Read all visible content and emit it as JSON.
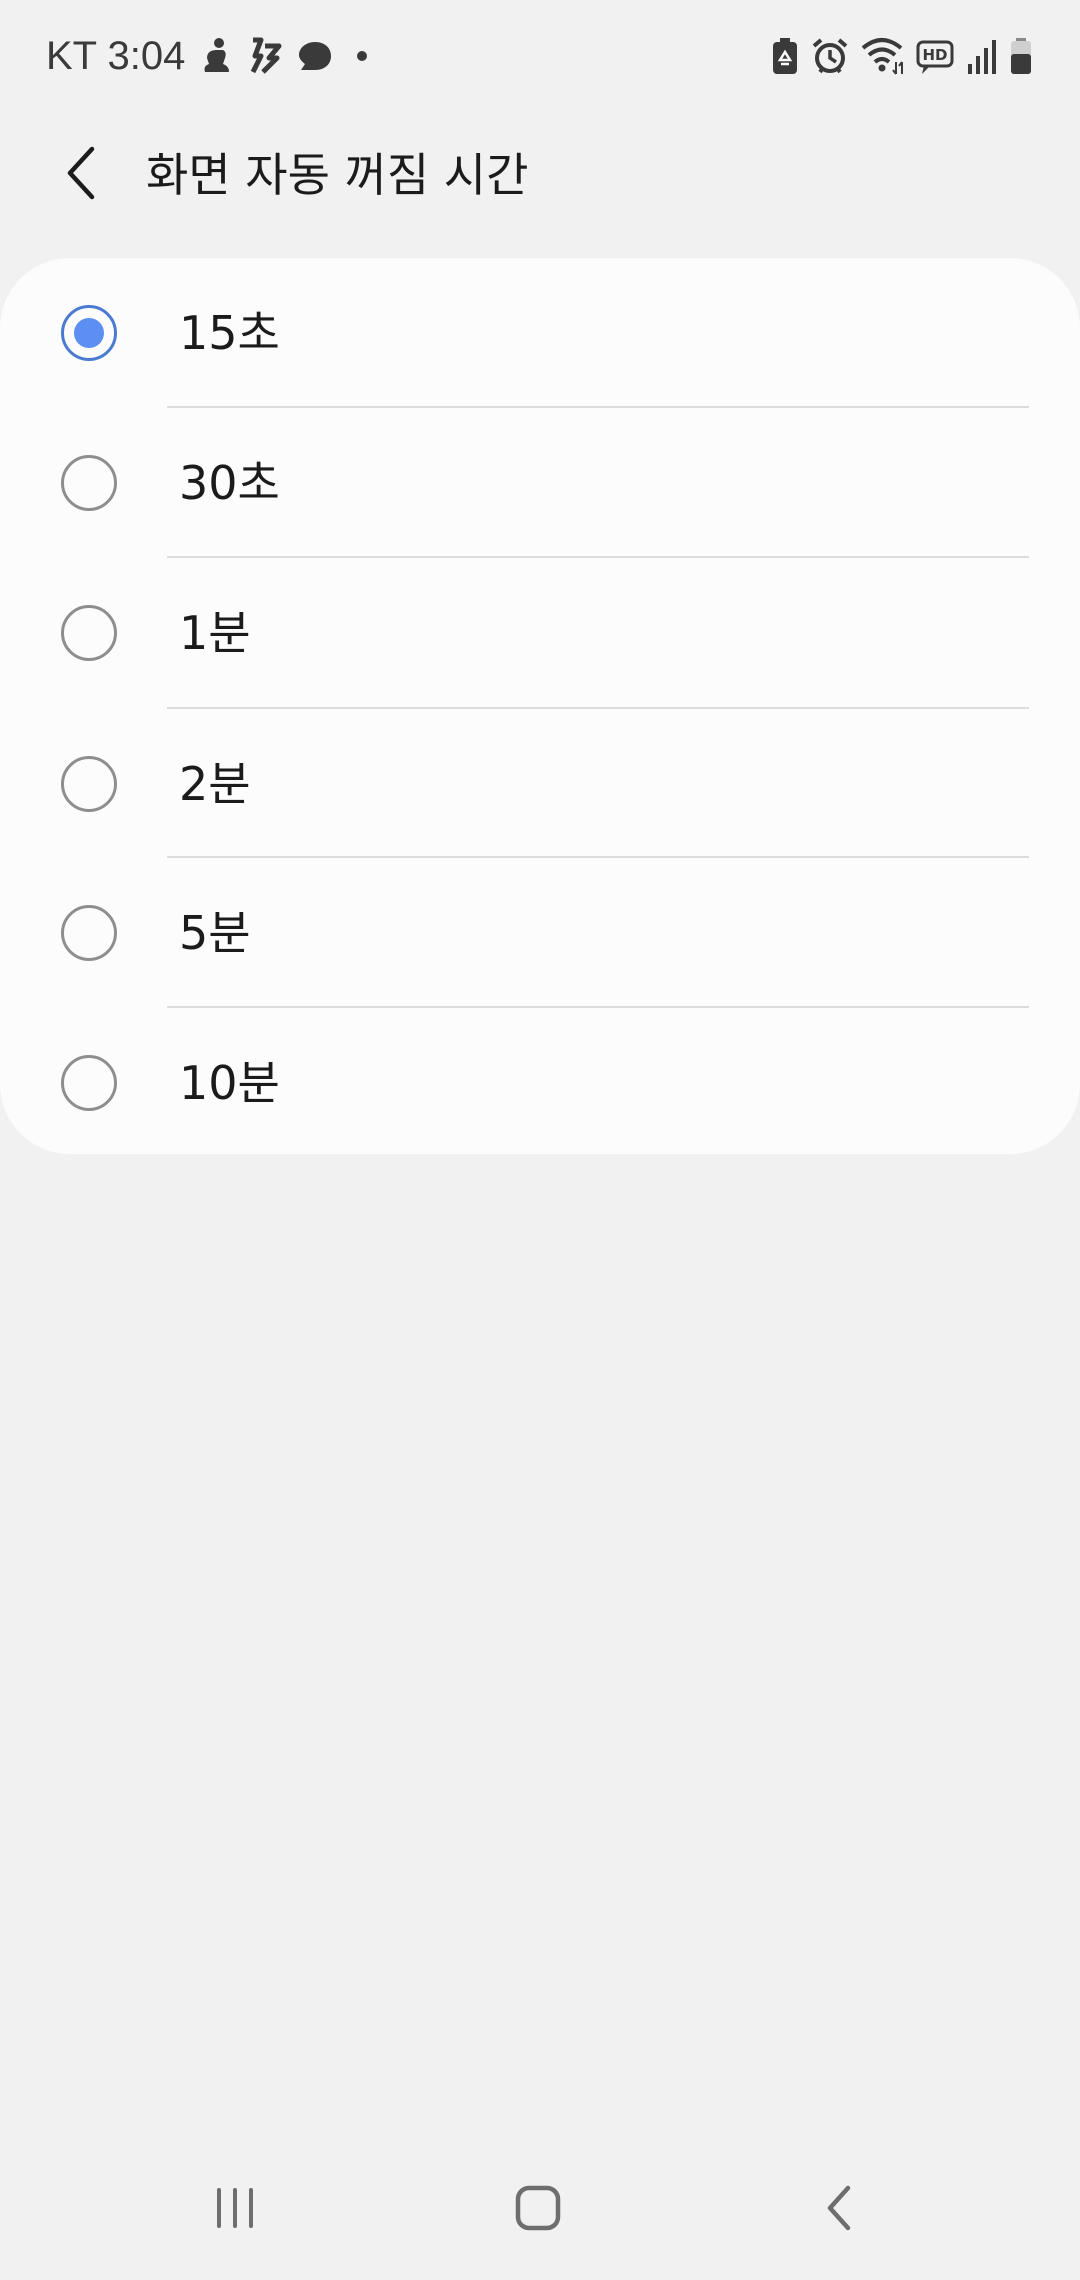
{
  "status_bar": {
    "text": "KT 3:04",
    "left_icons": [
      "figure-icon",
      "no-flash-icon",
      "chat-bubble-icon",
      "dot-icon"
    ],
    "right_icons": [
      "battery-saver-icon",
      "alarm-icon",
      "wifi-icon",
      "hd-voice-icon",
      "signal-icon",
      "battery-icon"
    ],
    "hd_label": "HD"
  },
  "header": {
    "title": "화면 자동 꺼짐 시간",
    "back_icon": "chevron-left-icon"
  },
  "options": {
    "items": [
      {
        "label": "15초",
        "selected": true
      },
      {
        "label": "30초",
        "selected": false
      },
      {
        "label": "1분",
        "selected": false
      },
      {
        "label": "2분",
        "selected": false
      },
      {
        "label": "5분",
        "selected": false
      },
      {
        "label": "10분",
        "selected": false
      }
    ]
  },
  "colors": {
    "accent": "#5d8ef2",
    "accent_ring": "#4a7bd0",
    "background": "#f1f1f1",
    "card": "#fcfcfc"
  },
  "nav_bar": {
    "icons": [
      "recent-apps-icon",
      "home-icon",
      "back-icon"
    ]
  }
}
